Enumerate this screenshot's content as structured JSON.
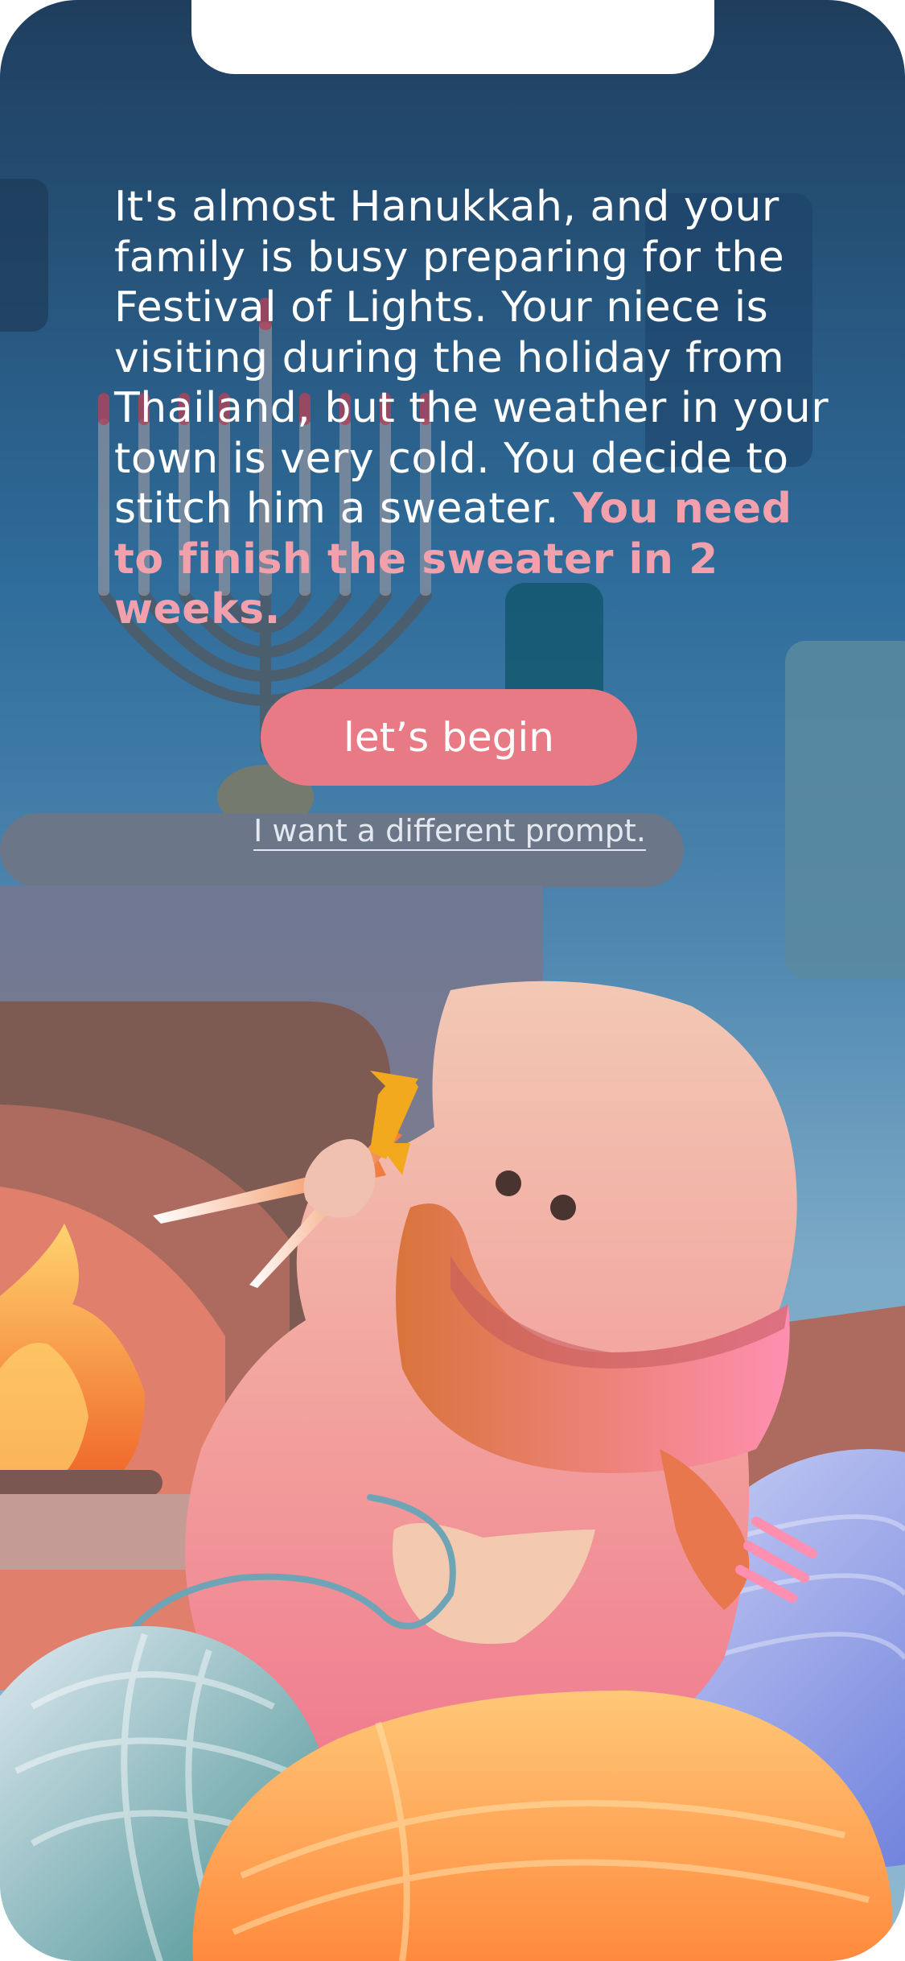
{
  "prompt": {
    "intro": "It's almost Hanukkah, and your family is busy preparing for the Festival of Lights. Your niece is visiting during the holiday from Thailand, but the weather in your town is very cold. You decide to stitch him a sweater.",
    "deadline": "You need to finish the sweater in 2 weeks."
  },
  "actions": {
    "begin_label": "let’s begin",
    "different_prompt_label": "I want a different prompt."
  },
  "colors": {
    "accent": "#e87a85",
    "deadline_text": "#f2a1ac",
    "sky_top": "#1f3e5e",
    "sky_bottom": "#8fb8d0"
  },
  "illustration": {
    "icons": [
      "menorah-icon",
      "fireplace-icon",
      "fire-icon",
      "character-knitting-icon",
      "knitting-needles-icon",
      "yarn-ball-teal-icon",
      "yarn-ball-orange-icon",
      "yarn-ball-blue-icon"
    ]
  }
}
